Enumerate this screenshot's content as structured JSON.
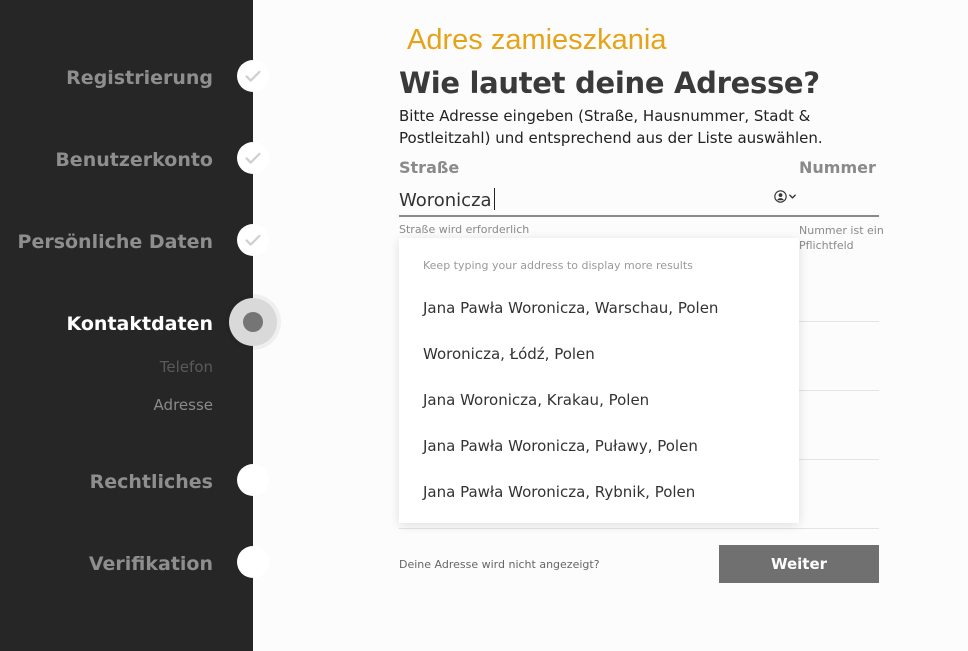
{
  "sidebar": {
    "steps": [
      {
        "label": "Registrierung",
        "state": "done"
      },
      {
        "label": "Benutzerkonto",
        "state": "done"
      },
      {
        "label": "Persönliche Daten",
        "state": "done"
      },
      {
        "label": "Kontaktdaten",
        "state": "active"
      },
      {
        "label": "Rechtliches",
        "state": "todo"
      },
      {
        "label": "Verifikation",
        "state": "todo"
      }
    ],
    "substeps": [
      {
        "label": "Telefon"
      },
      {
        "label": "Adresse"
      }
    ],
    "icons": {
      "done": "check-icon",
      "active": "current-step-icon",
      "todo": "empty-circle-icon"
    }
  },
  "main": {
    "section_label": "Adres zamieszkania",
    "title": "Wie lautet deine Adresse?",
    "intro": "Bitte Adresse eingeben (Straße, Hausnummer, Stadt & Postleitzahl) und entsprechend aus der Liste auswählen.",
    "street": {
      "label": "Straße",
      "value": "Woronicza",
      "error": "Straße wird erforderlich"
    },
    "number": {
      "label": "Nummer",
      "error": "Nummer ist ein Pflichtfeld"
    },
    "dropdown": {
      "hint": "Keep typing your address to display more results",
      "suggestions": [
        "Jana Pawła Woronicza, Warschau, Polen",
        "Woronicza, Łódź, Polen",
        "Jana Woronicza, Krakau, Polen",
        "Jana Pawła Woronicza, Puławy, Polen",
        "Jana Pawła Woronicza, Rybnik, Polen"
      ]
    },
    "bottom_note": "Deine Adresse wird nicht angezeigt?",
    "next_label": "Weiter"
  },
  "colors": {
    "sidebar_bg": "#262626",
    "accent": "#e5a318",
    "button_bg": "#707070"
  }
}
